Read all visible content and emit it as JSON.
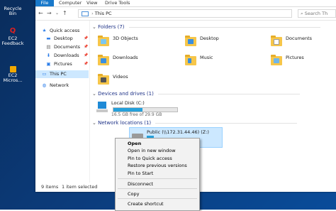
{
  "desktop": {
    "icons": [
      {
        "label": "Recycle Bin",
        "icon": "recycle-bin-icon"
      },
      {
        "label": "EC2\nFeedback",
        "icon": "ec2-feedback-icon"
      },
      {
        "label": "EC2\nMicros...",
        "icon": "ec2-microsoft-icon"
      }
    ]
  },
  "ribbon": {
    "tabs": [
      "File",
      "Computer",
      "View",
      "Drive Tools"
    ]
  },
  "address": {
    "path": "This PC",
    "search_placeholder": "Search Th"
  },
  "nav": {
    "quick_access": "Quick access",
    "items": [
      "Desktop",
      "Documents",
      "Downloads",
      "Pictures"
    ],
    "this_pc": "This PC",
    "network": "Network"
  },
  "sections": {
    "folders": "Folders (7)",
    "devices": "Devices and drives (1)",
    "network": "Network locations (1)"
  },
  "folders": [
    "3D Objects",
    "Desktop",
    "Documents",
    "Downloads",
    "Music",
    "Pictures",
    "Videos"
  ],
  "drive": {
    "name": "Local Disk (C:)",
    "space": "16.5 GB free of 29.9 GB",
    "used_fraction": 0.45
  },
  "network_drive": {
    "name": "Public (\\\\172.31.44.46) (Z:)"
  },
  "status": {
    "items": "9 items",
    "selected": "1 item selected"
  },
  "context_menu": {
    "open": "Open",
    "open_new_window": "Open in new window",
    "pin_quick": "Pin to Quick access",
    "restore": "Restore previous versions",
    "pin_start": "Pin to Start",
    "disconnect": "Disconnect",
    "copy": "Copy",
    "create_shortcut": "Create shortcut"
  },
  "colors": {
    "accent": "#1979ca",
    "folder": "#f6c64a",
    "selection": "#cce8ff",
    "header_text": "#1e3287"
  }
}
